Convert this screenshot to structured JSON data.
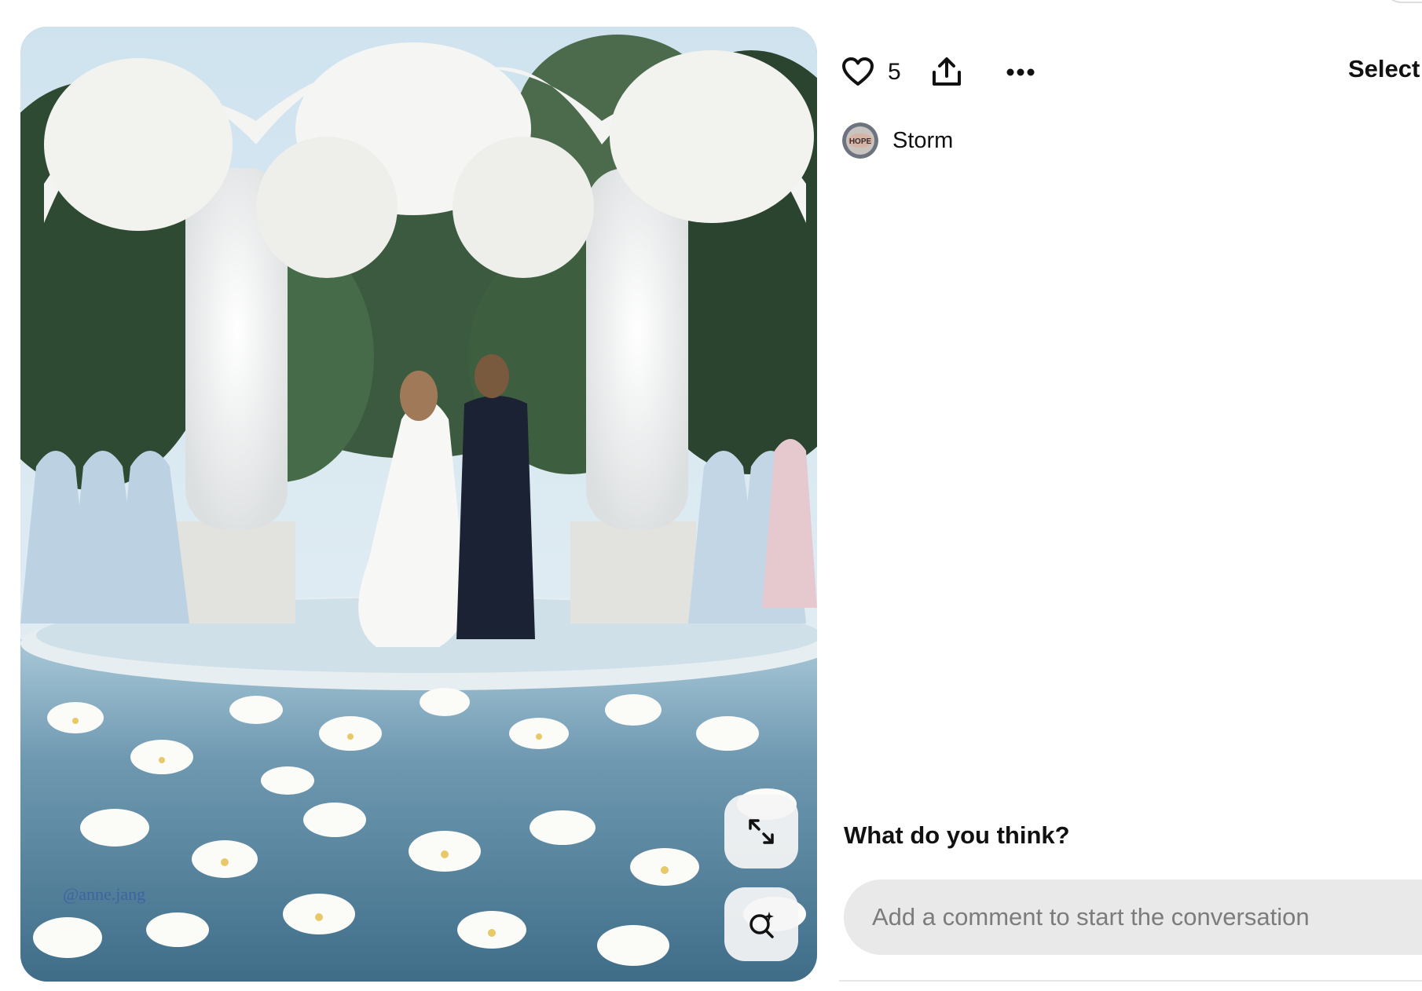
{
  "pin": {
    "watermark": "@anne.jang",
    "expand_label": "Expand image",
    "visual_search_label": "Visual search"
  },
  "actions": {
    "like_count": "5",
    "select_label": "Select"
  },
  "author": {
    "name": "Storm",
    "avatar_text": "HOPE"
  },
  "comments": {
    "heading": "What do you think?",
    "placeholder": "Add a comment to start the conversation"
  },
  "icons": {
    "like": "heart-icon",
    "share": "share-upload-icon",
    "more": "ellipsis-icon",
    "expand": "expand-arrows-icon",
    "lens": "visual-search-icon"
  }
}
